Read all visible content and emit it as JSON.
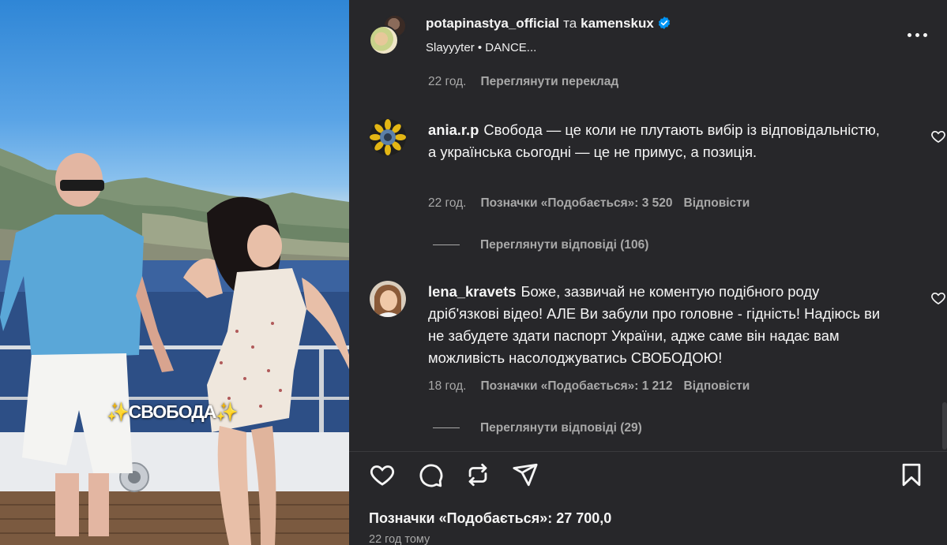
{
  "media": {
    "overlay_text": "✨СВОБОДА✨"
  },
  "header": {
    "author_primary": "potapinastya_official",
    "joiner": "та",
    "author_secondary": "kamenskux",
    "audio": "Slayyyter • DANCE..."
  },
  "comments": {
    "prev_meta": {
      "time": "22 год.",
      "translate": "Переглянути переклад"
    },
    "items": [
      {
        "username": "ania.r.p",
        "text": "Свобода — це коли не плутають вибір із відповідальністю, а українська сьогодні — це не примус, а позиція.",
        "time": "22 год.",
        "likes_label": "Позначки «Подобається»: 3 520",
        "reply_label": "Відповісти",
        "view_replies": "Переглянути відповіді (106)"
      },
      {
        "username": "lena_kravets",
        "text": "Боже, зазвичай не коментую подібного роду дріб'язкові відео! АЛЕ Ви забули про головне - гідність! Надіюсь ви не забудете здати паспорт України, адже саме він надає вам можливість насолоджуватись СВОБОДОЮ!",
        "time": "18 год.",
        "likes_label": "Позначки «Подобається»: 1 212",
        "reply_label": "Відповісти",
        "view_replies": "Переглянути відповіді (29)"
      }
    ]
  },
  "footer": {
    "likes_label": "Позначки «Подобається»: 27 700,0",
    "time_ago": "22 год тому"
  },
  "icons": {
    "like": "heart-icon",
    "comment": "comment-icon",
    "repost": "repost-icon",
    "share": "send-icon",
    "save": "bookmark-icon",
    "more": "more-icon",
    "verified": "verified-badge-icon"
  },
  "colors": {
    "panel_bg": "#27272a",
    "text_primary": "#f5f5f5",
    "text_secondary": "#a8a8a8",
    "verified_blue": "#0095f6"
  }
}
